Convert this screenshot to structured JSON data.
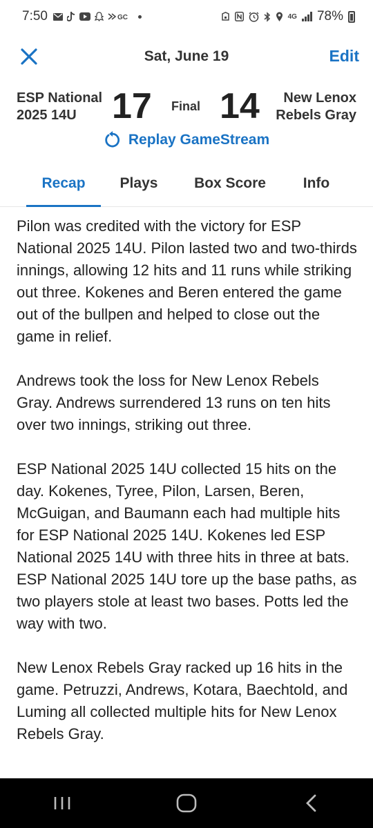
{
  "status_bar": {
    "time": "7:50",
    "battery": "78%",
    "network": "4G",
    "left_icons": [
      "mail-icon",
      "tiktok-icon",
      "youtube-icon",
      "snapchat-icon",
      "gamechanger-icon",
      "dot-icon"
    ],
    "right_icons": [
      "alarm-icon",
      "nfc-icon",
      "clock-icon",
      "bluetooth-icon",
      "location-icon",
      "signal-icon",
      "battery-icon"
    ]
  },
  "header": {
    "title": "Sat, June 19",
    "edit_label": "Edit"
  },
  "game": {
    "home_team_line1": "ESP National",
    "home_team_line2": "2025 14U",
    "home_score": "17",
    "status": "Final",
    "away_score": "14",
    "away_team_line1": "New Lenox",
    "away_team_line2": "Rebels Gray",
    "replay_label": "Replay GameStream"
  },
  "tabs": [
    {
      "label": "Recap",
      "active": true
    },
    {
      "label": "Plays",
      "active": false
    },
    {
      "label": "Box Score",
      "active": false
    },
    {
      "label": "Info",
      "active": false
    }
  ],
  "recap": {
    "paragraphs": [
      "Pilon was credited with the victory for ESP National 2025 14U. Pilon lasted two and two-thirds innings, allowing 12 hits and 11 runs while striking out three.  Kokenes and Beren entered the game out of the bullpen and helped to close out the game in relief.",
      "Andrews took the loss for New Lenox Rebels Gray. Andrews surrendered 13 runs on ten hits over two innings, striking out three.",
      "ESP National 2025 14U collected 15 hits on the day.  Kokenes, Tyree, Pilon, Larsen, Beren, McGuigan, and Baumann each had multiple hits for ESP National 2025 14U.  Kokenes led ESP National 2025 14U with three hits in three at bats.  ESP National 2025 14U tore up the base paths, as two players stole at least two bases. Potts led the way with two.",
      "New Lenox Rebels Gray racked up 16 hits in the game.  Petruzzi, Andrews, Kotara, Baechtold, and Luming all collected multiple hits for New Lenox Rebels Gray."
    ]
  },
  "nav": [
    "recents-icon",
    "home-icon",
    "back-icon"
  ],
  "colors": {
    "accent": "#1a73c4",
    "text": "#222222"
  }
}
